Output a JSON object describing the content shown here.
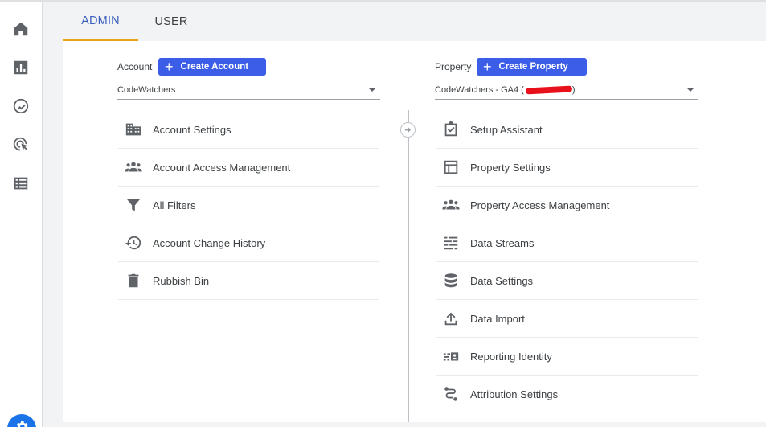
{
  "tabs": {
    "admin": "ADMIN",
    "user": "USER"
  },
  "account": {
    "label": "Account",
    "create_button": "Create Account",
    "selected": "CodeWatchers",
    "menu": [
      {
        "label": "Account Settings",
        "icon": "building-icon"
      },
      {
        "label": "Account Access Management",
        "icon": "people-icon"
      },
      {
        "label": "All Filters",
        "icon": "filter-icon"
      },
      {
        "label": "Account Change History",
        "icon": "history-icon"
      },
      {
        "label": "Rubbish Bin",
        "icon": "trash-icon"
      }
    ]
  },
  "property": {
    "label": "Property",
    "create_button": "Create Property",
    "selected_prefix": "CodeWatchers - GA4 (",
    "selected_suffix": ")",
    "menu": [
      {
        "label": "Setup Assistant",
        "icon": "clipboard-check-icon"
      },
      {
        "label": "Property Settings",
        "icon": "web-layout-icon"
      },
      {
        "label": "Property Access Management",
        "icon": "people-icon"
      },
      {
        "label": "Data Streams",
        "icon": "streams-icon"
      },
      {
        "label": "Data Settings",
        "icon": "database-icon"
      },
      {
        "label": "Data Import",
        "icon": "upload-icon"
      },
      {
        "label": "Reporting Identity",
        "icon": "identity-icon"
      },
      {
        "label": "Attribution Settings",
        "icon": "path-icon"
      }
    ]
  },
  "rail": [
    "home-icon",
    "reports-icon",
    "explore-icon",
    "advertising-icon",
    "configure-icon",
    "admin-gear-icon"
  ],
  "colors": {
    "accent": "#3b5de7",
    "tab_active_text": "#3c5fbd",
    "tab_underline": "#e8a317",
    "redaction": "#e8101a"
  }
}
